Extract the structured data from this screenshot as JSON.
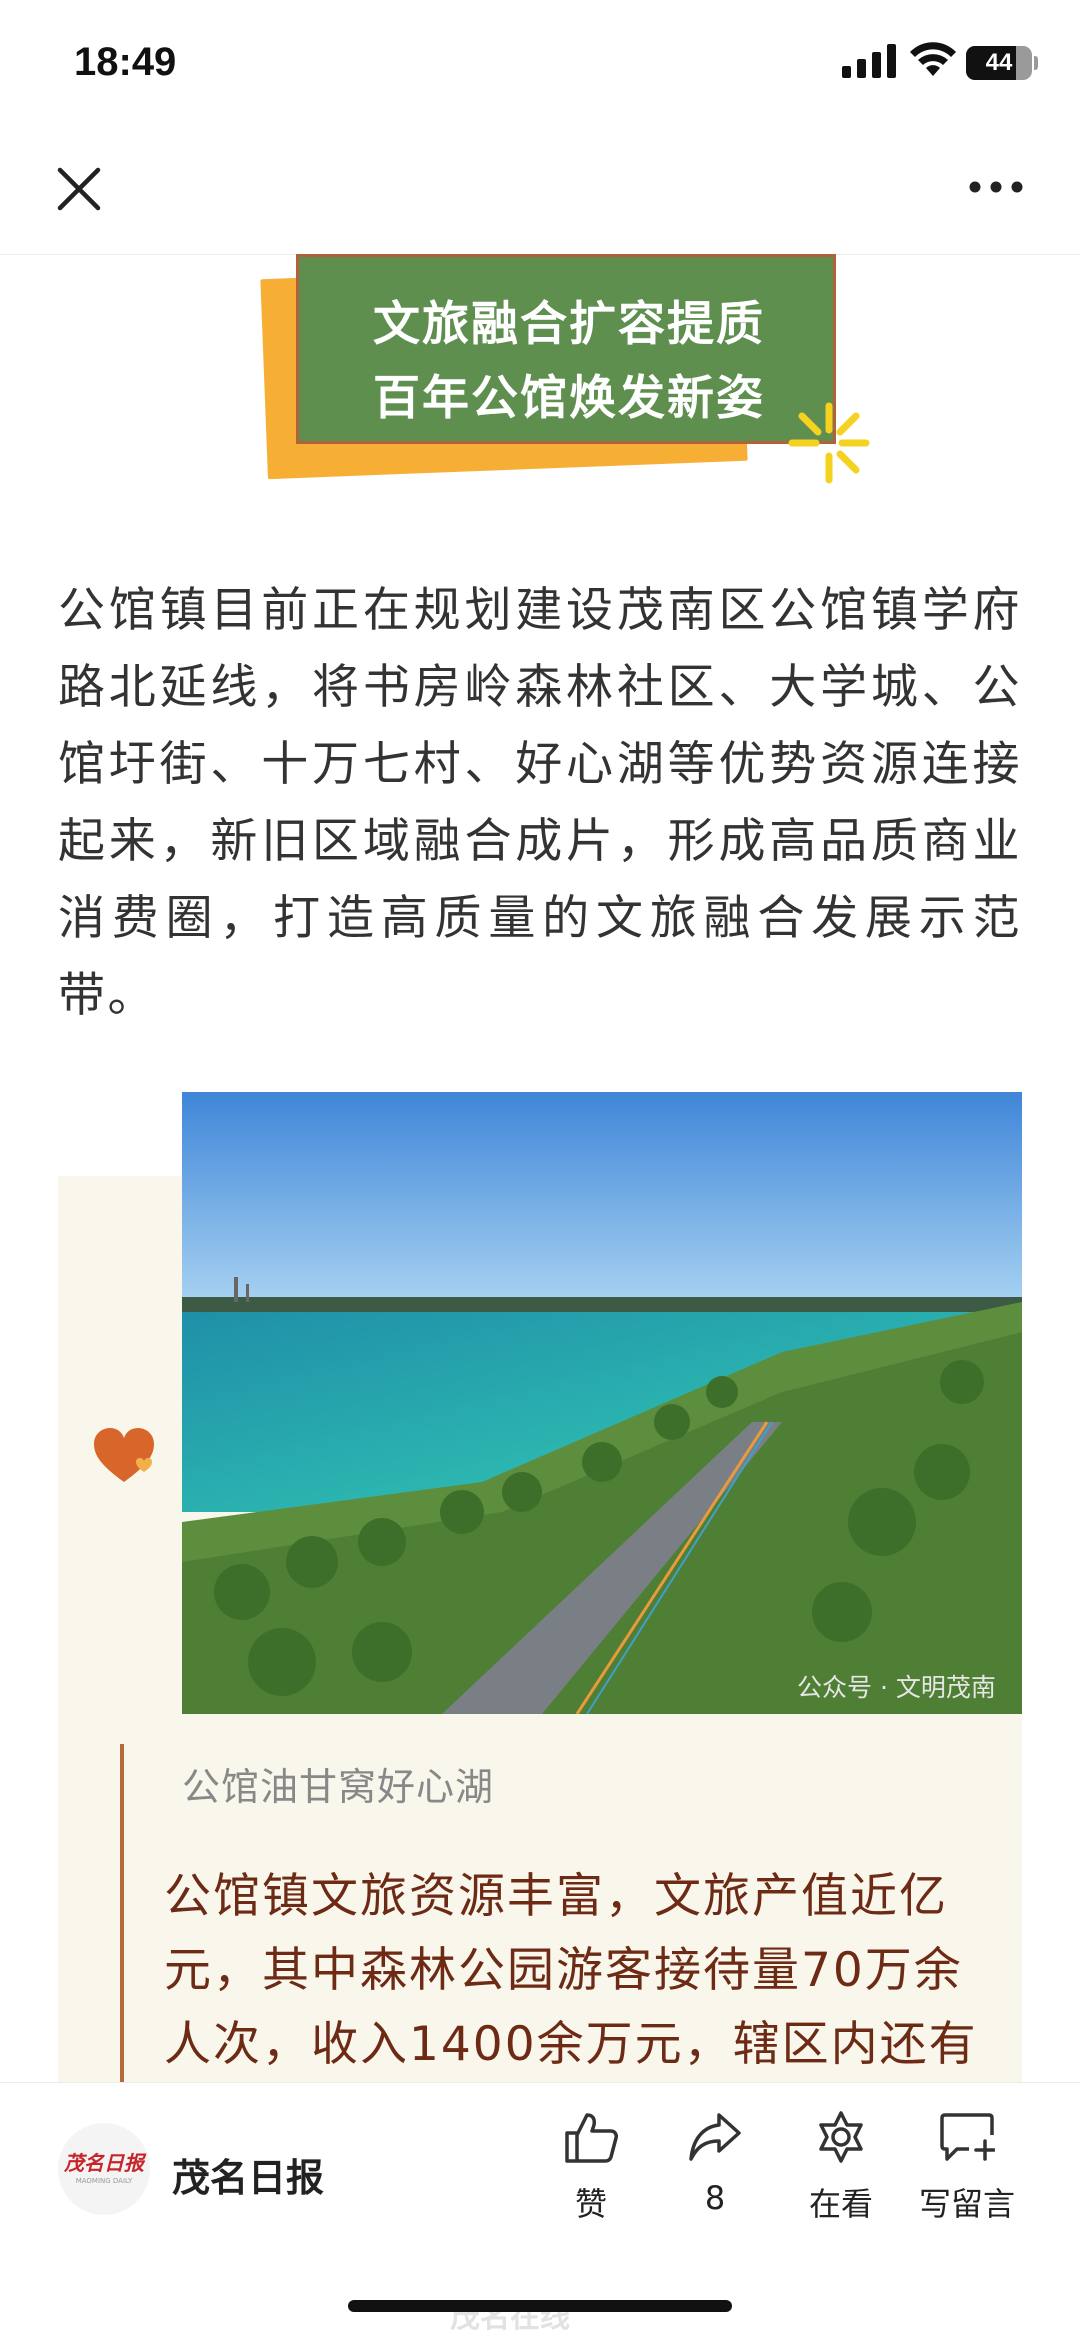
{
  "status_bar": {
    "time": "18:49",
    "battery": "44"
  },
  "nav": {
    "close_icon": "close-icon",
    "more_icon": "more-dots-icon"
  },
  "banner": {
    "line1": "文旅融合扩容提质",
    "line2": "百年公馆焕发新姿"
  },
  "article": {
    "paragraph": "公馆镇目前正在规划建设茂南区公馆镇学府路北延线，将书房岭森林社区、大学城、公馆圩街、十万七村、好心湖等优势资源连接起来，新旧区域融合成片，形成高品质商业消费圈，打造高质量的文旅融合发展示范带。"
  },
  "card": {
    "watermark": "公众号 · 文明茂南",
    "caption": "公馆油甘窝好心湖",
    "text": "公馆镇文旅资源丰富，文旅产值近亿元，其中森林公园游客接待量70万余人次，收入1400余万元，辖区内还有"
  },
  "bottom_bar": {
    "brand_name": "茂名日报",
    "logo_text": "茂名日报",
    "logo_sub": "MAOMING DAILY",
    "like_label": "赞",
    "share_count": "8",
    "watching_label": "在看",
    "comment_label": "写留言"
  },
  "site_watermark": "茂名在线",
  "colors": {
    "banner_green": "#5e8f4f",
    "banner_orange": "#f6ae35",
    "card_bg": "#f9f6ec",
    "card_text": "#6d2a14",
    "accent_brown": "#b56a3a"
  }
}
